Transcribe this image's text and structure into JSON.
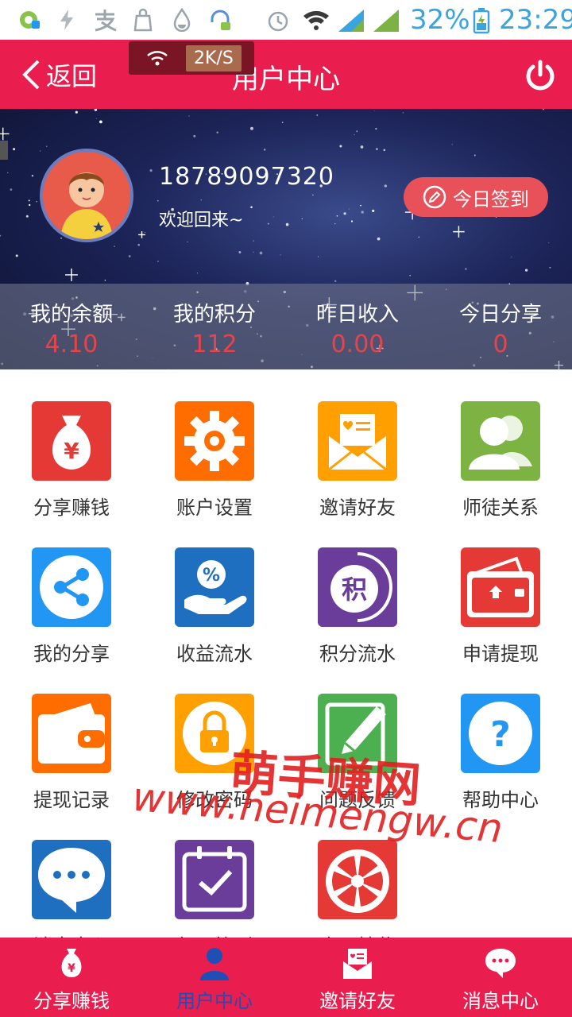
{
  "status_bar": {
    "battery": "32%",
    "time": "23:29"
  },
  "header": {
    "back_label": "返回",
    "title": "用户中心",
    "network_speed": "2K/S"
  },
  "profile": {
    "phone": "18789097320",
    "welcome": "欢迎回来~",
    "checkin_label": "今日签到"
  },
  "stats": [
    {
      "label": "我的余额",
      "value": "4.10"
    },
    {
      "label": "我的积分",
      "value": "112"
    },
    {
      "label": "昨日收入",
      "value": "0.00"
    },
    {
      "label": "今日分享",
      "value": "0"
    }
  ],
  "menu": [
    {
      "label": "分享赚钱",
      "icon": "money-bag-icon",
      "color": "#e53935"
    },
    {
      "label": "账户设置",
      "icon": "gear-icon",
      "color": "#ff6d00"
    },
    {
      "label": "邀请好友",
      "icon": "envelope-icon",
      "color": "#ffa000"
    },
    {
      "label": "师徒关系",
      "icon": "users-icon",
      "color": "#7cb342"
    },
    {
      "label": "我的分享",
      "icon": "share-icon",
      "color": "#2196f3"
    },
    {
      "label": "收益流水",
      "icon": "percent-hand-icon",
      "color": "#1e6fc0"
    },
    {
      "label": "积分流水",
      "icon": "points-icon",
      "color": "#6a3d9a"
    },
    {
      "label": "申请提现",
      "icon": "wallet-up-icon",
      "color": "#e53935"
    },
    {
      "label": "提现记录",
      "icon": "wallet-icon",
      "color": "#ff6d00"
    },
    {
      "label": "修改密码",
      "icon": "lock-icon",
      "color": "#ffa000"
    },
    {
      "label": "问题反馈",
      "icon": "pencil-icon",
      "color": "#4caf50"
    },
    {
      "label": "帮助中心",
      "icon": "question-icon",
      "color": "#2196f3"
    },
    {
      "label": "消息中心",
      "icon": "chat-icon",
      "color": "#1e6fc0"
    },
    {
      "label": "每日签到",
      "icon": "calendar-check-icon",
      "color": "#6a3d9a"
    },
    {
      "label": "幸运抽奖",
      "icon": "wheel-icon",
      "color": "#e53935"
    }
  ],
  "watermark": {
    "title": "萌手赚网",
    "url": "www.heimengw.cn"
  },
  "bottom_nav": [
    {
      "label": "分享赚钱",
      "icon": "money-bag-icon",
      "active": false
    },
    {
      "label": "用户中心",
      "icon": "user-icon",
      "active": true
    },
    {
      "label": "邀请好友",
      "icon": "envelope-icon",
      "active": false
    },
    {
      "label": "消息中心",
      "icon": "chat-icon",
      "active": false
    }
  ],
  "colors": {
    "brand": "#e91e4e",
    "stat_value": "#e8434a",
    "nav_active": "#1f4fb5"
  }
}
